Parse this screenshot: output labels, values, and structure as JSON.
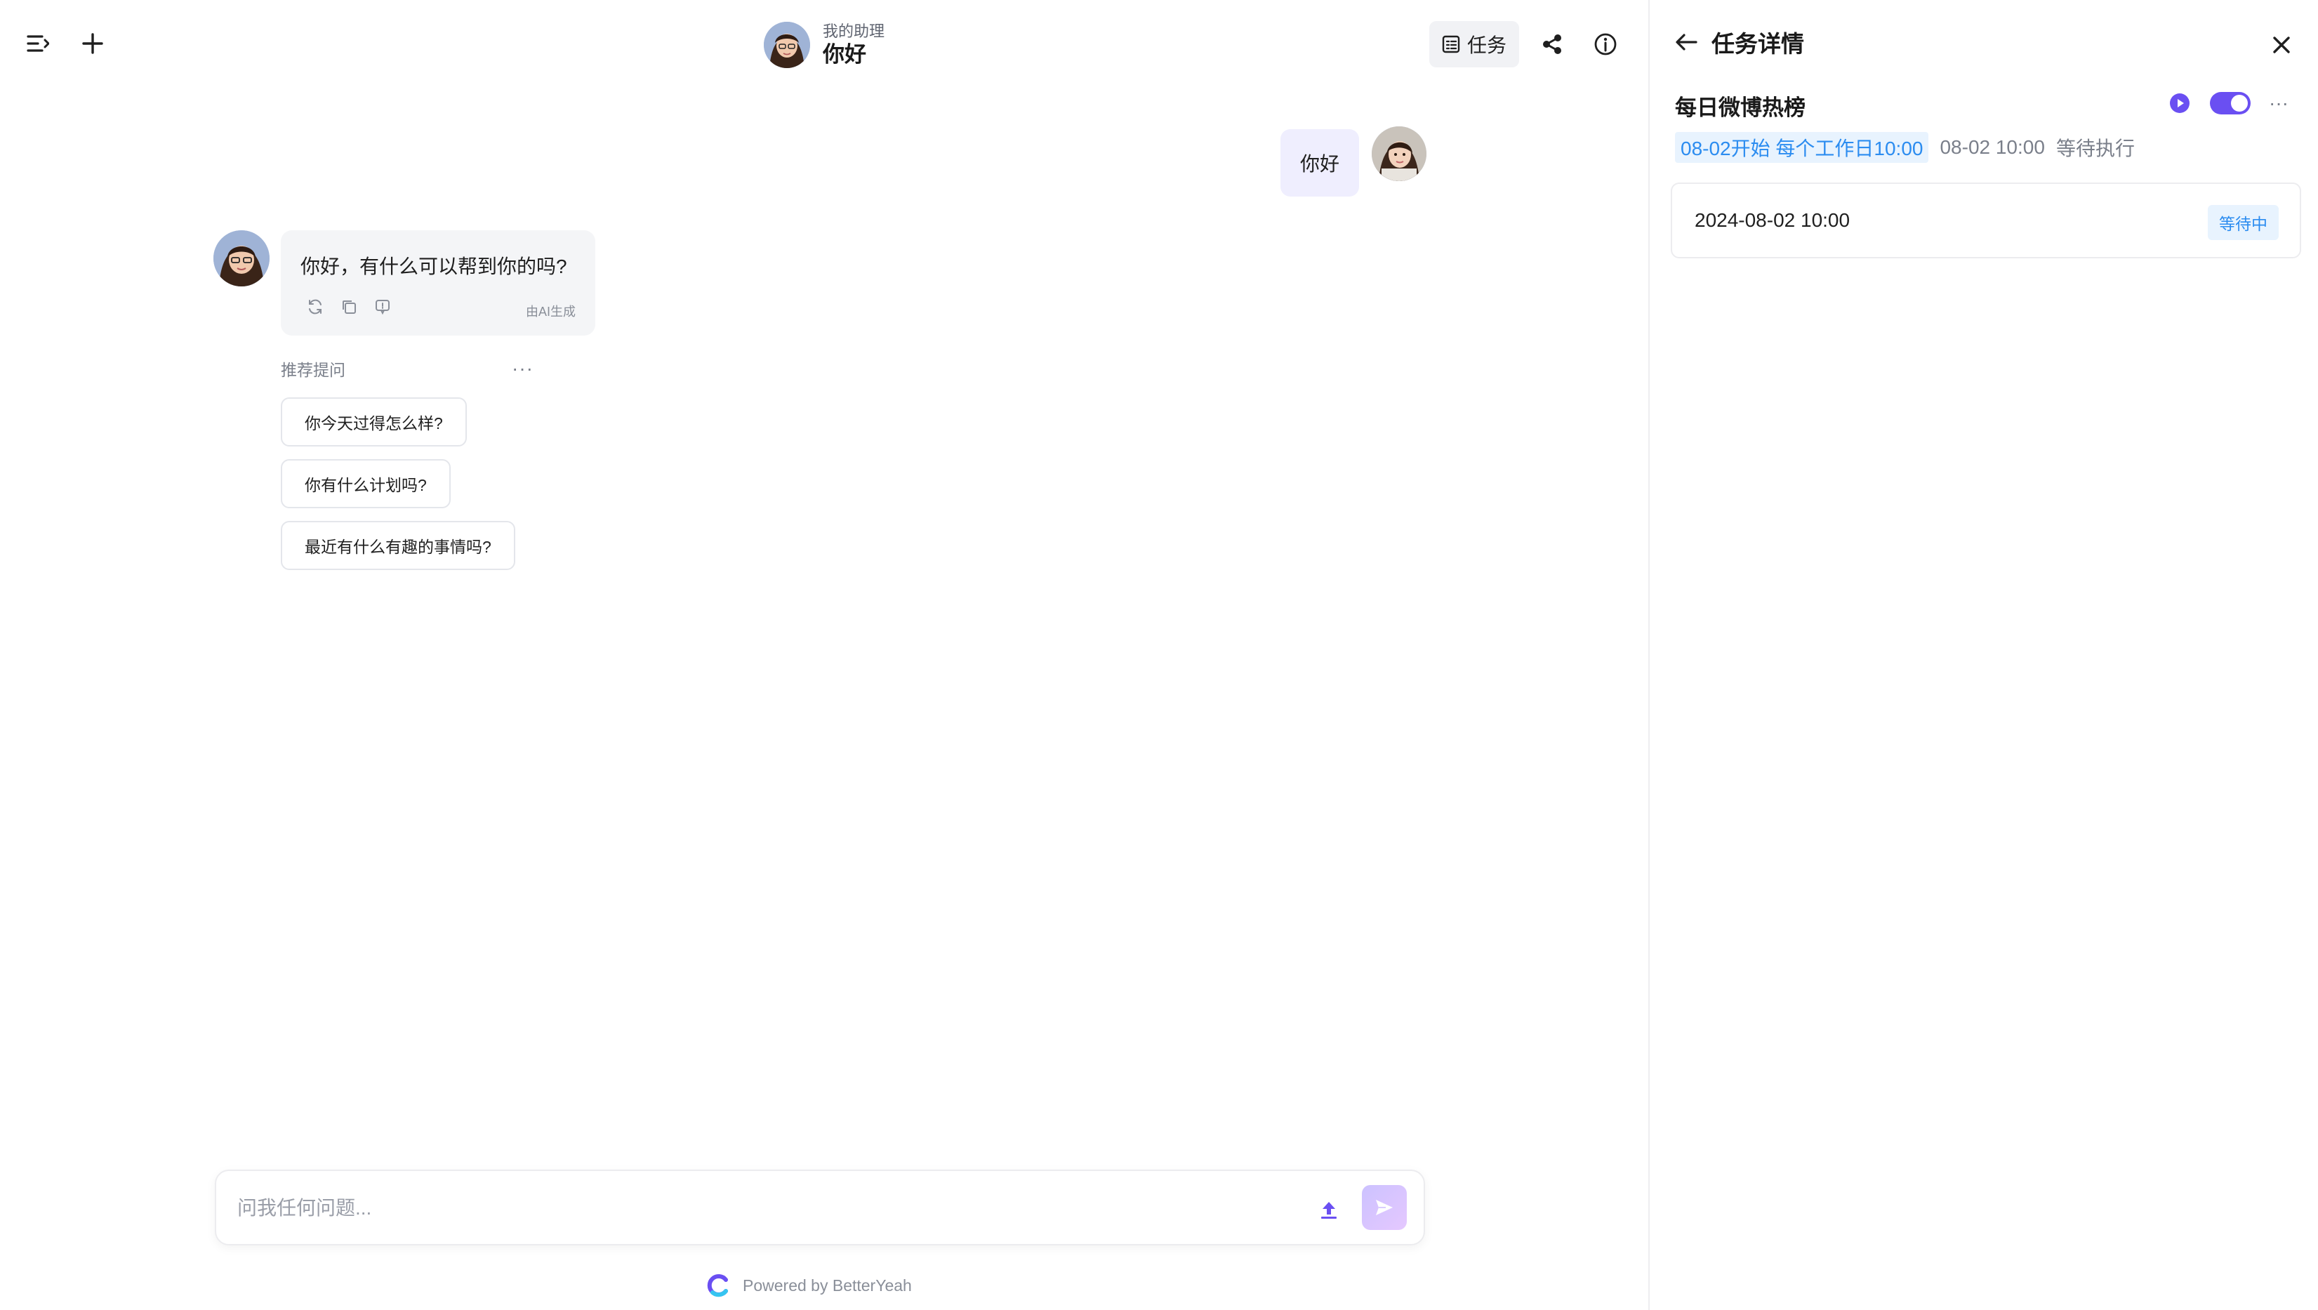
{
  "header": {
    "assistant_subtitle": "我的助理",
    "chat_title": "你好",
    "task_button_label": "任务"
  },
  "messages": {
    "user_text": "你好",
    "bot_text": "你好，有什么可以帮到你的吗?",
    "ai_generated_label": "由AI生成"
  },
  "suggestions": {
    "label": "推荐提问",
    "more": "···",
    "items": [
      "你今天过得怎么样?",
      "你有什么计划吗?",
      "最近有什么有趣的事情吗?"
    ]
  },
  "input": {
    "placeholder": "问我任何问题..."
  },
  "footer": {
    "powered_by": "Powered by BetterYeah"
  },
  "task_panel": {
    "title": "任务详情",
    "task_name": "每日微博热榜",
    "schedule": "08-02开始 每个工作日10:00",
    "next_run": "08-02 10:00",
    "status_text": "等待执行",
    "more": "···",
    "enabled": true,
    "runs": [
      {
        "time": "2024-08-02 10:00",
        "status": "等待中"
      }
    ]
  },
  "colors": {
    "accent": "#6a4ff2",
    "tag_blue": "#2b8cf0",
    "tag_bg": "#e8f3fe"
  },
  "icons": [
    "menu-icon",
    "plus-icon",
    "task-list-icon",
    "share-icon",
    "info-icon",
    "back-arrow-icon",
    "close-icon",
    "play-icon",
    "regenerate-icon",
    "copy-icon",
    "feedback-icon",
    "upload-icon",
    "send-icon",
    "betteryeah-logo-icon"
  ]
}
